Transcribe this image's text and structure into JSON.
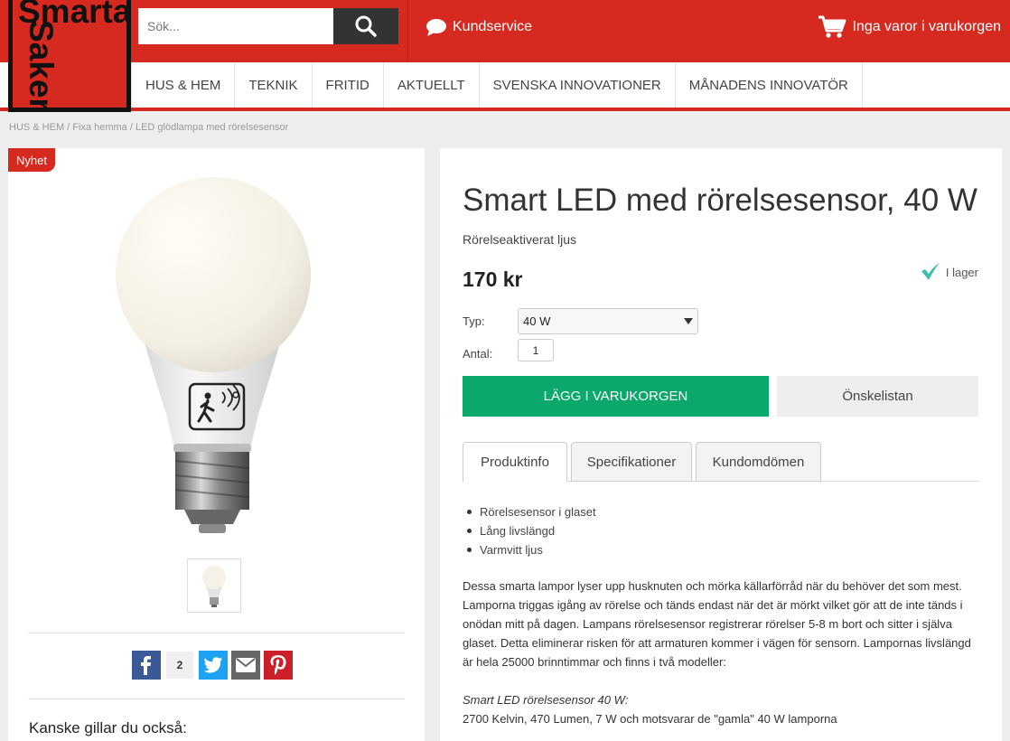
{
  "header": {
    "logo_line1": "Smarta",
    "logo_line2": "Saker",
    "search_placeholder": "Sök...",
    "customer_service": "Kundservice",
    "cart_text": "Inga varor i varukorgen"
  },
  "nav": {
    "items": [
      "HUS & HEM",
      "TEKNIK",
      "FRITID",
      "AKTUELLT",
      "SVENSKA INNOVATIONER",
      "MÅNADENS INNOVATÖR"
    ]
  },
  "breadcrumb": "HUS & HEM / Fixa hemma / LED glödlampa med rörelsesensor",
  "left_panel": {
    "badge": "Nyhet",
    "share_count": "2",
    "also_like": "Kanske gillar du också:"
  },
  "product": {
    "title": "Smart LED med rörelsesensor, 40 W",
    "subtitle": "Rörelseaktiverat ljus",
    "price": "170 kr",
    "stock": "I lager",
    "type_label": "Typ:",
    "type_value": "40 W",
    "qty_label": "Antal:",
    "qty_value": "1",
    "buy_button": "LÄGG I VARUKORGEN",
    "wishlist_button": "Önskelistan"
  },
  "tabs": [
    "Produktinfo",
    "Specifikationer",
    "Kundomdömen"
  ],
  "info": {
    "bullets": [
      "Rörelsesensor i glaset",
      "Lång livslängd",
      "Varmvitt ljus"
    ],
    "description": "Dessa smarta lampor lyser upp husknuten och mörka källarförråd när du behöver det som mest. Lamporna triggas igång av rörelse och tänds endast när det är mörkt vilket gör att de inte tänds i onödan mitt på dagen. Lampans rörelsesensor registrerar rörelser 5-8 m bort och sitter i själva glaset. Detta eliminerar risken för att armaturen kommer i vägen för sensorn. Lampornas livslängd är hela 25000 brinntimmar och finns i två modeller:",
    "model_name": "Smart LED rörelsesensor 40 W:",
    "model_specs": "2700 Kelvin, 470 Lumen, 7 W och motsvarar de \"gamla\" 40 W lamporna"
  },
  "colors": {
    "brand_red": "#d62a20",
    "buy_green": "#0aa86b",
    "check_teal": "#3fbfa8",
    "facebook": "#3b5998",
    "twitter": "#1da1f2",
    "email": "#666666",
    "pinterest": "#cb2027"
  },
  "icons": [
    "search-icon",
    "chat-bubble-icon",
    "cart-icon",
    "checkmark-icon",
    "facebook-icon",
    "twitter-icon",
    "email-icon",
    "pinterest-icon"
  ]
}
